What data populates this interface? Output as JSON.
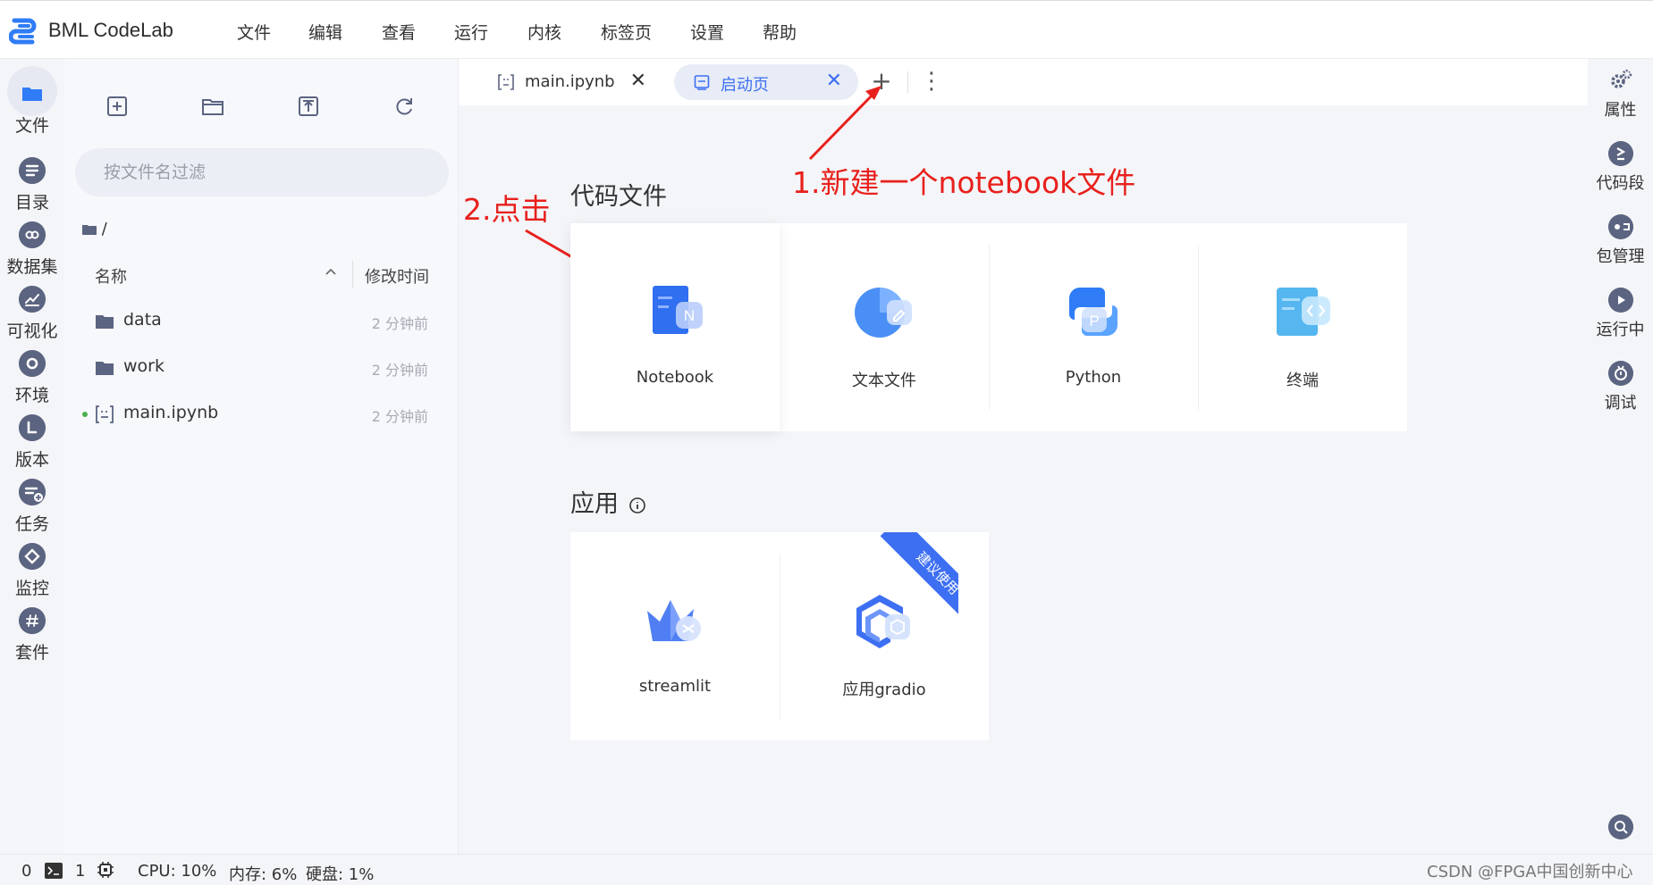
{
  "app": {
    "title": "BML CodeLab"
  },
  "menu": [
    "文件",
    "编辑",
    "查看",
    "运行",
    "内核",
    "标签页",
    "设置",
    "帮助"
  ],
  "left_rail": [
    {
      "label": "文件",
      "icon": "folder-icon",
      "active": true
    },
    {
      "label": "目录",
      "icon": "list-icon"
    },
    {
      "label": "数据集",
      "icon": "dataset-icon"
    },
    {
      "label": "可视化",
      "icon": "chart-icon"
    },
    {
      "label": "环境",
      "icon": "environment-icon"
    },
    {
      "label": "版本",
      "icon": "version-icon"
    },
    {
      "label": "任务",
      "icon": "task-icon"
    },
    {
      "label": "监控",
      "icon": "monitor-icon"
    },
    {
      "label": "套件",
      "icon": "suite-icon"
    }
  ],
  "file_panel": {
    "filter_placeholder": "按文件名过滤",
    "breadcrumb": "/",
    "columns": {
      "name": "名称",
      "modified": "修改时间"
    },
    "files": [
      {
        "name": "data",
        "type": "folder",
        "modified": "2 分钟前"
      },
      {
        "name": "work",
        "type": "folder",
        "modified": "2 分钟前"
      },
      {
        "name": "main.ipynb",
        "type": "notebook",
        "modified": "2 分钟前",
        "running": true
      }
    ]
  },
  "tabs": [
    {
      "label": "main.ipynb",
      "icon": "notebook-icon",
      "active": false
    },
    {
      "label": "启动页",
      "icon": "launcher-icon",
      "active": true
    }
  ],
  "launcher": {
    "code_section_title": "代码文件",
    "code_cards": [
      "Notebook",
      "文本文件",
      "Python",
      "终端"
    ],
    "app_section_title": "应用",
    "app_cards": [
      "streamlit",
      "应用gradio"
    ],
    "ribbon": "建议使用"
  },
  "right_rail": [
    "属性",
    "代码段",
    "包管理",
    "运行中",
    "调试"
  ],
  "status": {
    "terminals": "0",
    "kernels": "1",
    "cpu": "CPU:  10%",
    "mem": "内存:  6%",
    "disk": "硬盘:  1%"
  },
  "annotations": {
    "step1": "1.新建一个notebook文件",
    "step2": "2.点击"
  },
  "watermark": "CSDN @FPGA中国创新中心",
  "colors": {
    "accent": "#3d6ff2",
    "annotation": "#e8201c",
    "rail_icon": "#5b6480"
  }
}
